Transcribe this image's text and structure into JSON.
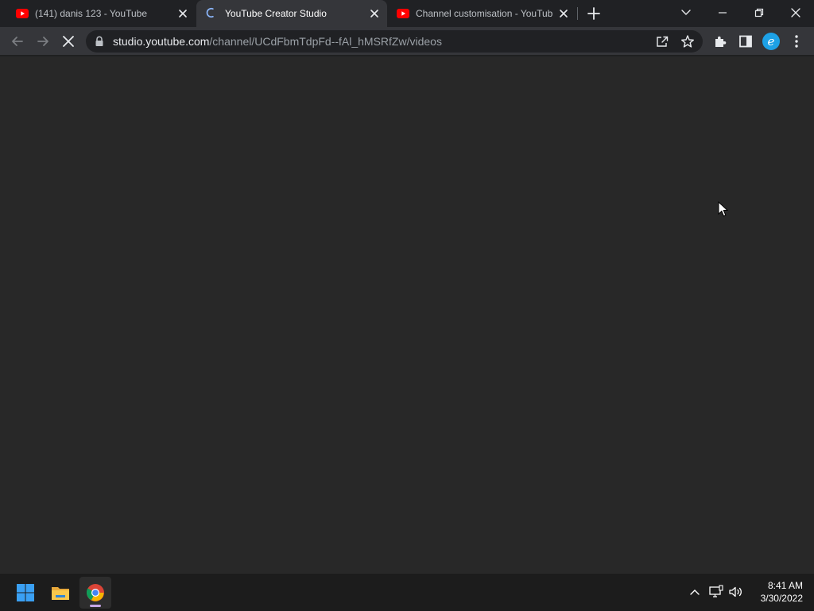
{
  "browser": {
    "tabs": [
      {
        "title": "(141) danis 123 - YouTube",
        "favicon": "youtube-icon",
        "active": false
      },
      {
        "title": "YouTube Creator Studio",
        "favicon": "loading-spinner-icon",
        "active": true
      },
      {
        "title": "Channel customisation - YouTube",
        "favicon": "youtube-icon",
        "active": false
      }
    ],
    "address": {
      "host": "studio.youtube.com",
      "path": "/channel/UCdFbmTdpFd--fAl_hMSRfZw/videos"
    },
    "profile_initial": "e"
  },
  "colors": {
    "youtube_red": "#ff0000",
    "accent_blue": "#8ab4f8",
    "page_background": "#282828",
    "profile_avatar": "#1da1e6"
  },
  "taskbar": {
    "apps": [
      "windows-start-icon",
      "file-explorer-icon",
      "chrome-icon"
    ],
    "tray_icons": [
      "chevron-up-icon",
      "network-icon",
      "volume-icon"
    ],
    "time": "8:41 AM",
    "date": "3/30/2022"
  }
}
